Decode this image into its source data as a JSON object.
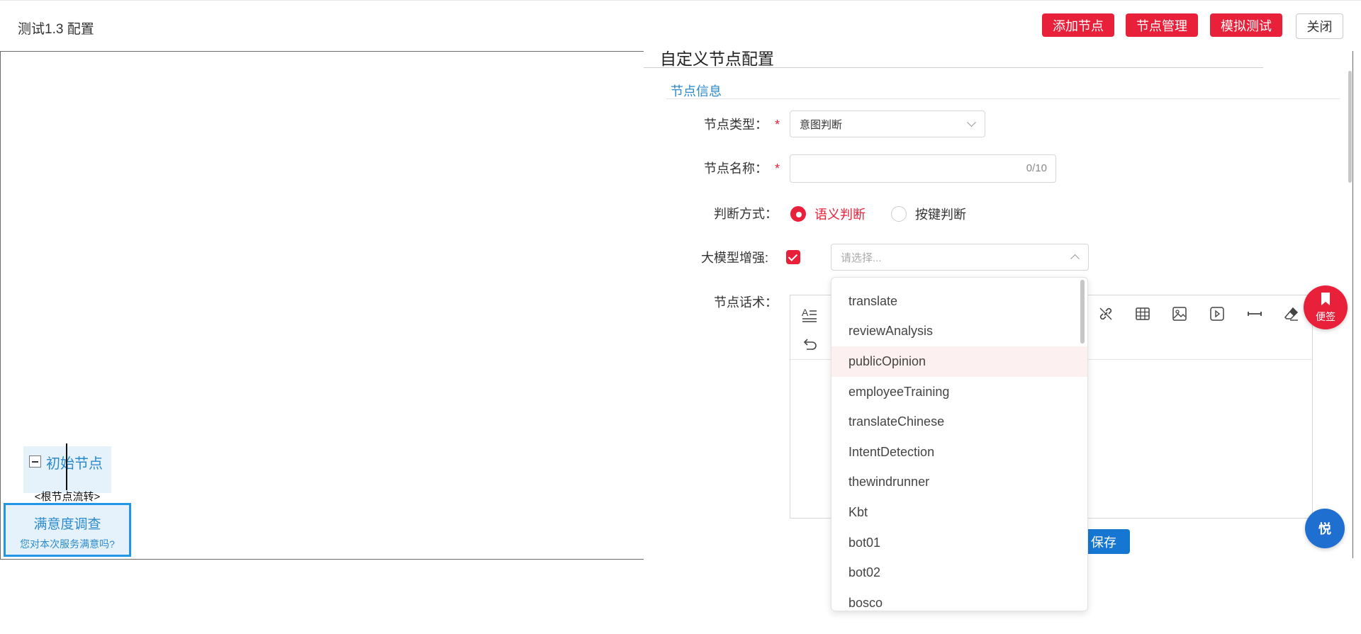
{
  "header": {
    "title": "测试1.3 配置",
    "buttons": {
      "add_node": "添加节点",
      "node_manage": "节点管理",
      "simulate": "模拟测试",
      "close": "关闭"
    }
  },
  "canvas": {
    "root_node": {
      "label": "初始节点"
    },
    "flow_label": "<根节点流转>",
    "child_node": {
      "title": "满意度调查",
      "subtitle": "您对本次服务满意吗?"
    }
  },
  "panel": {
    "title": "自定义节点配置",
    "section_title": "节点信息",
    "fields": {
      "node_type": {
        "label": "节点类型：",
        "value": "意图判断"
      },
      "node_name": {
        "label": "节点名称：",
        "value": "",
        "counter": "0/10"
      },
      "judge_mode": {
        "label": "判断方式：",
        "options": [
          "语义判断",
          "按键判断"
        ],
        "selected": "语义判断"
      },
      "llm_enhance": {
        "label": "大模型增强:",
        "checked": true,
        "placeholder": "请选择..."
      },
      "node_script": {
        "label": "节点话术："
      }
    },
    "save_label": "保存"
  },
  "dropdown": {
    "items": [
      "translate",
      "reviewAnalysis",
      "publicOpinion",
      "employeeTraining",
      "translateChinese",
      "IntentDetection",
      "thewindrunner",
      "Kbt",
      "bot01",
      "bot02",
      "bosco"
    ],
    "highlighted": "publicOpinion"
  },
  "floating": {
    "note_label": "便签",
    "chat_label": "悦"
  },
  "colors": {
    "primary_red": "#e8203a",
    "primary_blue": "#1677d2",
    "node_blue": "#2b8acc"
  }
}
